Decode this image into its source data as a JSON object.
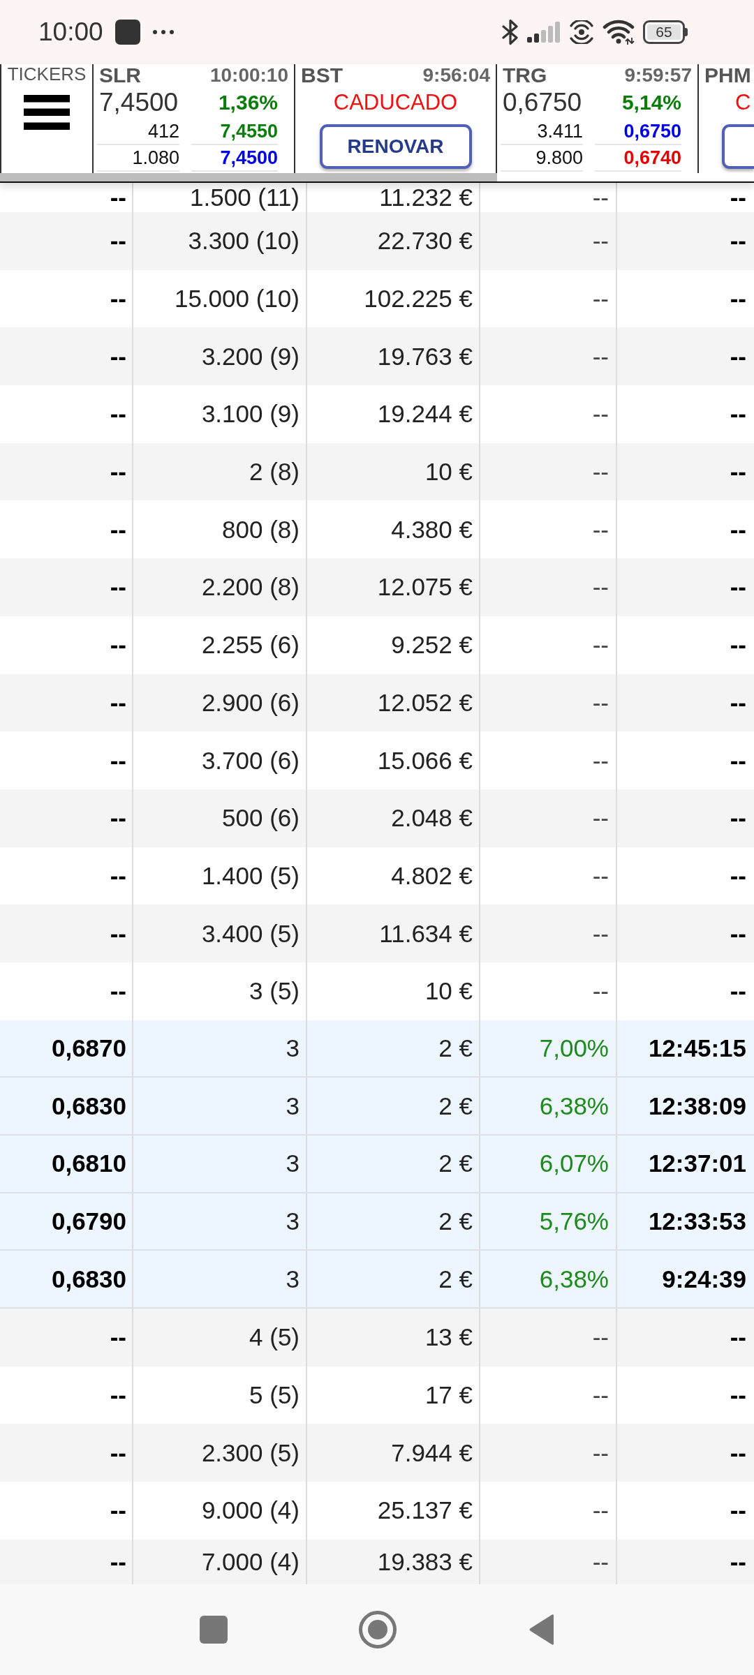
{
  "status_bar": {
    "time": "10:00",
    "battery": "65"
  },
  "ticker_strip": {
    "label": "TICKERS",
    "tickers": [
      {
        "kind": "live",
        "symbol": "SLR",
        "time": "10:00:10",
        "price": "7,4500",
        "change": "1,36%",
        "quotes": [
          {
            "size": "412",
            "price": "7,4550",
            "color": "#0a7d0a"
          },
          {
            "size": "1.080",
            "price": "7,4500",
            "color": "#0000e6"
          }
        ]
      },
      {
        "kind": "expired",
        "symbol": "BST",
        "time": "9:56:04",
        "status": "CADUCADO",
        "action": "RENOVAR"
      },
      {
        "kind": "live",
        "symbol": "TRG",
        "time": "9:59:57",
        "price": "0,6750",
        "change": "5,14%",
        "quotes": [
          {
            "size": "3.411",
            "price": "0,6750",
            "color": "#0000e6"
          },
          {
            "size": "9.800",
            "price": "0,6740",
            "color": "#e60000"
          }
        ]
      },
      {
        "kind": "expired",
        "symbol": "PHM",
        "status": "C"
      }
    ]
  },
  "table": {
    "rows": [
      {
        "highlighted": false,
        "cells": [
          "--",
          "1.500 (11)",
          "11.232 €",
          "--",
          "--"
        ]
      },
      {
        "highlighted": false,
        "cells": [
          "--",
          "3.300 (10)",
          "22.730 €",
          "--",
          "--"
        ]
      },
      {
        "highlighted": false,
        "cells": [
          "--",
          "15.000 (10)",
          "102.225 €",
          "--",
          "--"
        ]
      },
      {
        "highlighted": false,
        "cells": [
          "--",
          "3.200 (9)",
          "19.763 €",
          "--",
          "--"
        ]
      },
      {
        "highlighted": false,
        "cells": [
          "--",
          "3.100 (9)",
          "19.244 €",
          "--",
          "--"
        ]
      },
      {
        "highlighted": false,
        "cells": [
          "--",
          "2 (8)",
          "10 €",
          "--",
          "--"
        ]
      },
      {
        "highlighted": false,
        "cells": [
          "--",
          "800 (8)",
          "4.380 €",
          "--",
          "--"
        ]
      },
      {
        "highlighted": false,
        "cells": [
          "--",
          "2.200 (8)",
          "12.075 €",
          "--",
          "--"
        ]
      },
      {
        "highlighted": false,
        "cells": [
          "--",
          "2.255 (6)",
          "9.252 €",
          "--",
          "--"
        ]
      },
      {
        "highlighted": false,
        "cells": [
          "--",
          "2.900 (6)",
          "12.052 €",
          "--",
          "--"
        ]
      },
      {
        "highlighted": false,
        "cells": [
          "--",
          "3.700 (6)",
          "15.066 €",
          "--",
          "--"
        ]
      },
      {
        "highlighted": false,
        "cells": [
          "--",
          "500 (6)",
          "2.048 €",
          "--",
          "--"
        ]
      },
      {
        "highlighted": false,
        "cells": [
          "--",
          "1.400 (5)",
          "4.802 €",
          "--",
          "--"
        ]
      },
      {
        "highlighted": false,
        "cells": [
          "--",
          "3.400 (5)",
          "11.634 €",
          "--",
          "--"
        ]
      },
      {
        "highlighted": false,
        "cells": [
          "--",
          "3 (5)",
          "10 €",
          "--",
          "--"
        ]
      },
      {
        "highlighted": true,
        "cells": [
          "0,6870",
          "3",
          "2 €",
          "7,00%",
          "12:45:15"
        ]
      },
      {
        "highlighted": true,
        "cells": [
          "0,6830",
          "3",
          "2 €",
          "6,38%",
          "12:38:09"
        ]
      },
      {
        "highlighted": true,
        "cells": [
          "0,6810",
          "3",
          "2 €",
          "6,07%",
          "12:37:01"
        ]
      },
      {
        "highlighted": true,
        "cells": [
          "0,6790",
          "3",
          "2 €",
          "5,76%",
          "12:33:53"
        ]
      },
      {
        "highlighted": true,
        "cells": [
          "0,6830",
          "3",
          "2 €",
          "6,38%",
          "9:24:39"
        ]
      },
      {
        "highlighted": false,
        "cells": [
          "--",
          "4 (5)",
          "13 €",
          "--",
          "--"
        ]
      },
      {
        "highlighted": false,
        "cells": [
          "--",
          "5 (5)",
          "17 €",
          "--",
          "--"
        ]
      },
      {
        "highlighted": false,
        "cells": [
          "--",
          "2.300 (5)",
          "7.944 €",
          "--",
          "--"
        ]
      },
      {
        "highlighted": false,
        "cells": [
          "--",
          "9.000 (4)",
          "25.137 €",
          "--",
          "--"
        ]
      },
      {
        "highlighted": false,
        "cells": [
          "--",
          "7.000 (4)",
          "19.383 €",
          "--",
          "--"
        ]
      }
    ]
  }
}
